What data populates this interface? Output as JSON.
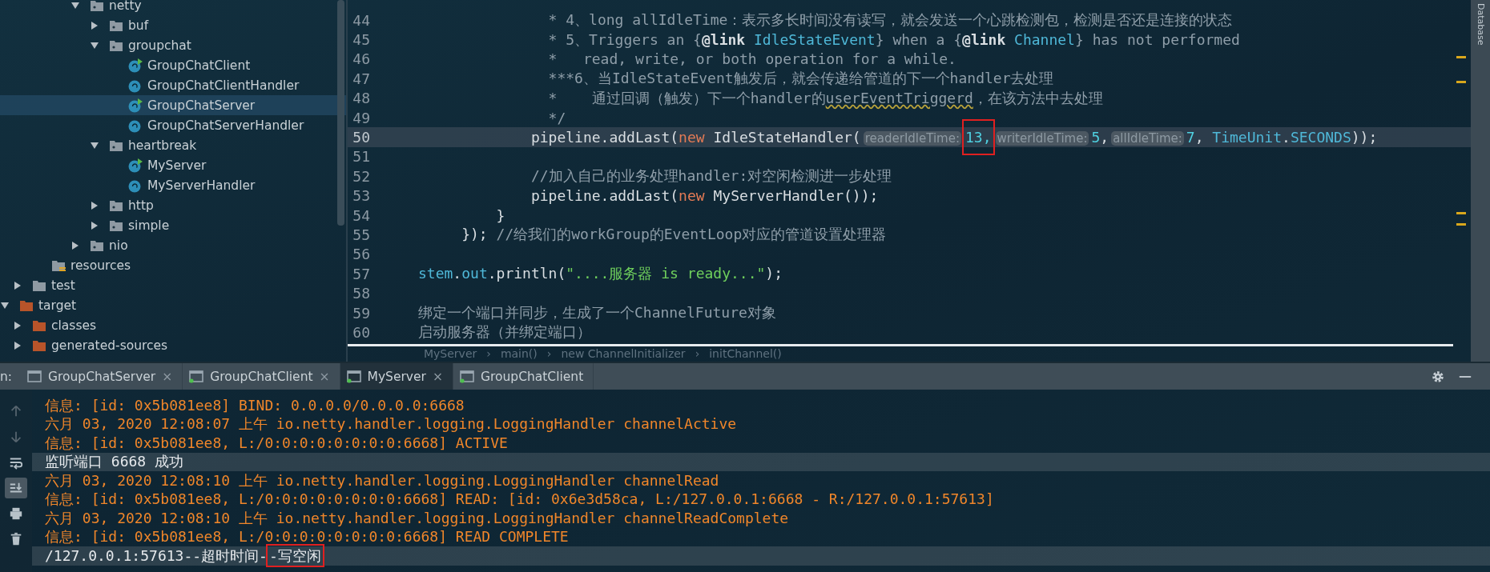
{
  "project_tree": {
    "items": [
      {
        "children": [
          {
            "children": [
              {
                "children": [
                  {
                    "children": [
                      {
                        "label": "netty",
                        "kind": "package",
                        "expanded": true,
                        "selected": false,
                        "children": [
                          {
                            "label": "buf",
                            "kind": "package",
                            "expanded": false,
                            "selected": false
                          },
                          {
                            "label": "groupchat",
                            "kind": "package",
                            "expanded": true,
                            "selected": false,
                            "children": [
                              {
                                "label": "GroupChatClient",
                                "kind": "class",
                                "runnable": true,
                                "selected": false
                              },
                              {
                                "label": "GroupChatClientHandler",
                                "kind": "class",
                                "selected": false
                              },
                              {
                                "label": "GroupChatServer",
                                "kind": "class",
                                "runnable": true,
                                "selected": true
                              },
                              {
                                "label": "GroupChatServerHandler",
                                "kind": "class",
                                "selected": false
                              }
                            ]
                          },
                          {
                            "label": "heartbreak",
                            "kind": "package",
                            "expanded": true,
                            "selected": false,
                            "children": [
                              {
                                "label": "MyServer",
                                "kind": "class",
                                "runnable": true,
                                "selected": false
                              },
                              {
                                "label": "MyServerHandler",
                                "kind": "class",
                                "selected": false
                              }
                            ]
                          },
                          {
                            "label": "http",
                            "kind": "package",
                            "expanded": false,
                            "selected": false
                          },
                          {
                            "label": "simple",
                            "kind": "package",
                            "expanded": false,
                            "selected": false
                          }
                        ]
                      },
                      {
                        "label": "nio",
                        "kind": "package",
                        "expanded": false,
                        "selected": false
                      }
                    ]
                  }
                ]
              },
              {
                "label": "resources",
                "kind": "resources",
                "selected": false
              }
            ]
          },
          {
            "label": "test",
            "kind": "folder",
            "expanded": false,
            "selected": false
          }
        ]
      },
      {
        "label": "target",
        "kind": "excluded",
        "expanded": true,
        "selected": false,
        "children": [
          {
            "label": "classes",
            "kind": "excluded",
            "expanded": false,
            "selected": false
          },
          {
            "label": "generated-sources",
            "kind": "excluded",
            "expanded": false,
            "selected": false
          }
        ]
      }
    ]
  },
  "editor": {
    "lines": [
      {
        "number": "44",
        "tokens": [
          {
            "text": "               * 4、long allIdleTime：表示多长时间没有读写，就会发送一个心跳检测包，检测是否还是连接的状态",
            "kind": "comment"
          }
        ]
      },
      {
        "number": "45",
        "tokens": [
          {
            "text": "               * 5、Triggers an {",
            "kind": "comment"
          },
          {
            "text": "@link",
            "kind": "tag"
          },
          {
            "text": " IdleStateEvent",
            "kind": "link"
          },
          {
            "text": "} when a {",
            "kind": "comment"
          },
          {
            "text": "@link",
            "kind": "tag"
          },
          {
            "text": " Channel",
            "kind": "link"
          },
          {
            "text": "} has not performed",
            "kind": "comment"
          }
        ]
      },
      {
        "number": "46",
        "tokens": [
          {
            "text": "               *   read, write, or both operation for a while.",
            "kind": "comment"
          }
        ]
      },
      {
        "number": "47",
        "tokens": [
          {
            "text": "               ***6、当IdleStateEvent触发后，就会传递给管道的下一个handler去处理",
            "kind": "comment"
          }
        ]
      },
      {
        "number": "48",
        "tokens": [
          {
            "text": "               *    通过回调（触发）下一个handler的",
            "kind": "comment"
          },
          {
            "text": "userEventTriggerd",
            "kind": "typo"
          },
          {
            "text": "，在该方法中去处理",
            "kind": "comment"
          }
        ]
      },
      {
        "number": "49",
        "tokens": [
          {
            "text": "               */",
            "kind": "comment"
          }
        ]
      },
      {
        "number": "50",
        "current": true,
        "tokens": [
          {
            "text": "             pipeline.addLast(",
            "kind": "plain"
          },
          {
            "text": "new",
            "kind": "keyword"
          },
          {
            "text": " IdleStateHandler(",
            "kind": "plain"
          },
          {
            "text": "readerIdleTime:",
            "kind": "hint"
          },
          {
            "text": "13,",
            "kind": "number",
            "boxed": true
          },
          {
            "text": "writerIdleTime:",
            "kind": "hint"
          },
          {
            "text": "5",
            "kind": "number"
          },
          {
            "text": ",",
            "kind": "plain"
          },
          {
            "text": "allIdleTime:",
            "kind": "hint"
          },
          {
            "text": "7",
            "kind": "number"
          },
          {
            "text": ", ",
            "kind": "plain"
          },
          {
            "text": "TimeUnit",
            "kind": "type"
          },
          {
            "text": ".",
            "kind": "plain"
          },
          {
            "text": "SECONDS",
            "kind": "type"
          },
          {
            "text": "));",
            "kind": "plain"
          }
        ]
      },
      {
        "number": "51"
      },
      {
        "number": "52",
        "tokens": [
          {
            "text": "             //加入自己的业务处理handler:对空闲检测进一步处理",
            "kind": "comment"
          }
        ]
      },
      {
        "number": "53",
        "tokens": [
          {
            "text": "             pipeline.addLast(",
            "kind": "plain"
          },
          {
            "text": "new",
            "kind": "keyword"
          },
          {
            "text": " MyServerHandler());",
            "kind": "plain"
          }
        ]
      },
      {
        "number": "54",
        "tokens": [
          {
            "text": "         }",
            "kind": "plain"
          }
        ]
      },
      {
        "number": "55",
        "tokens": [
          {
            "text": "     }); ",
            "kind": "plain"
          },
          {
            "text": "//给我们的workGroup的EventLoop对应的管道设置处理器",
            "kind": "comment"
          }
        ]
      },
      {
        "number": "56"
      },
      {
        "number": "57",
        "tokens": [
          {
            "text": "stem",
            "kind": "type"
          },
          {
            "text": ".",
            "kind": "plain"
          },
          {
            "text": "out",
            "kind": "type"
          },
          {
            "text": ".println(",
            "kind": "plain"
          },
          {
            "text": "\"....服务器 is ready...\"",
            "kind": "string"
          },
          {
            "text": ");",
            "kind": "plain"
          }
        ]
      },
      {
        "number": "58"
      },
      {
        "number": "59",
        "tokens": [
          {
            "text": "绑定一个端口并同步，生成了一个ChannelFuture对象",
            "kind": "comment"
          }
        ]
      },
      {
        "number": "60",
        "tokens": [
          {
            "text": "启动服务器（并绑定端口）",
            "kind": "comment"
          }
        ]
      }
    ],
    "breadcrumb": {
      "separator": "›",
      "items": [
        "MyServer",
        "main()",
        "new ChannelInitializer",
        "initChannel()"
      ]
    }
  },
  "right_strip": {
    "label": "Database"
  },
  "run_panel": {
    "label": "n:",
    "tabs": [
      {
        "label": "GroupChatServer",
        "selected": false,
        "running": false,
        "closable": true
      },
      {
        "label": "GroupChatClient",
        "selected": false,
        "running": true,
        "closable": true
      },
      {
        "label": "MyServer",
        "selected": true,
        "running": true,
        "closable": true
      },
      {
        "label": "GroupChatClient",
        "selected": false,
        "running": true,
        "closable": false
      }
    ],
    "close_mark": "×",
    "toolbar": [
      {
        "kind": "up",
        "disabled": true,
        "selected": false
      },
      {
        "kind": "down",
        "disabled": true,
        "selected": false
      },
      {
        "kind": "wrap",
        "disabled": false,
        "selected": false
      },
      {
        "kind": "scroll-end",
        "disabled": false,
        "selected": true
      },
      {
        "kind": "print",
        "disabled": false,
        "selected": false
      },
      {
        "kind": "trash",
        "disabled": false,
        "selected": false
      }
    ],
    "console": [
      {
        "kind": "stderr",
        "segments": [
          {
            "text": "信息: [id: 0x5b081ee8] BIND: 0.0.0.0/0.0.0.0:6668"
          }
        ]
      },
      {
        "kind": "stderr",
        "segments": [
          {
            "text": "六月 03, 2020 12:08:07 上午 io.netty.handler.logging.LoggingHandler channelActive"
          }
        ]
      },
      {
        "kind": "stderr",
        "segments": [
          {
            "text": "信息: [id: 0x5b081ee8, L:/0:0:0:0:0:0:0:0:6668] ACTIVE"
          }
        ]
      },
      {
        "kind": "stdout",
        "segments": [
          {
            "text": "监听端口 6668 成功"
          }
        ]
      },
      {
        "kind": "stderr",
        "segments": [
          {
            "text": "六月 03, 2020 12:08:10 上午 io.netty.handler.logging.LoggingHandler channelRead"
          }
        ]
      },
      {
        "kind": "stderr",
        "segments": [
          {
            "text": "信息: [id: 0x5b081ee8, L:/0:0:0:0:0:0:0:0:6668] READ: [id: 0x6e3d58ca, L:/127.0.0.1:6668 - R:/127.0.0.1:57613]"
          }
        ]
      },
      {
        "kind": "stderr",
        "segments": [
          {
            "text": "六月 03, 2020 12:08:10 上午 io.netty.handler.logging.LoggingHandler channelReadComplete"
          }
        ]
      },
      {
        "kind": "stderr",
        "segments": [
          {
            "text": "信息: [id: 0x5b081ee8, L:/0:0:0:0:0:0:0:0:6668] READ COMPLETE"
          }
        ]
      },
      {
        "kind": "stdout",
        "segments": [
          {
            "text": "/127.0.0.1:57613--超时时间-"
          },
          {
            "text": "-写空闲",
            "boxed": true
          }
        ]
      }
    ]
  }
}
